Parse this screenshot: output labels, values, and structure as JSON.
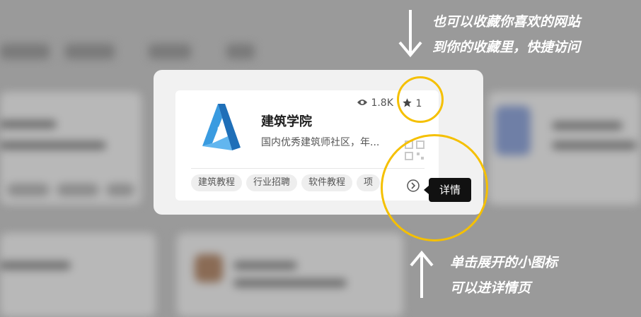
{
  "card": {
    "title": "建筑学院",
    "description": "国内优秀建筑师社区，年...",
    "views": "1.8K",
    "favorites": "1",
    "tags": [
      "建筑教程",
      "行业招聘",
      "软件教程",
      "项"
    ],
    "tooltip": "详情"
  },
  "annotations": {
    "favorite_hint": [
      "也可以收藏你喜欢的网站",
      "到你的收藏里，快捷访问"
    ],
    "detail_hint": [
      "单击展开的小图标",
      "可以进详情页"
    ]
  },
  "icons": {
    "views": "eye-icon",
    "favorites": "star-icon",
    "qr": "qr-code-icon",
    "detail": "chevron-right-circle-icon",
    "arrow_down": "arrow-down-icon",
    "arrow_up": "arrow-up-icon"
  },
  "colors": {
    "highlight_ring": "#f5c000",
    "logo_blue": "#2f8fd8",
    "tooltip_bg": "#111111"
  }
}
